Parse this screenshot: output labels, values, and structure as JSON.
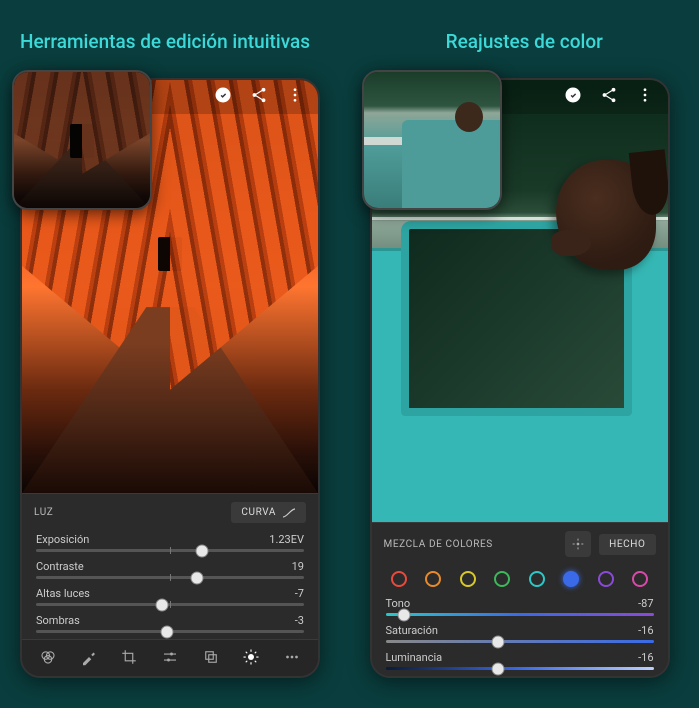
{
  "left": {
    "headline": "Herramientas de edición intuitivas",
    "panel_title": "LUZ",
    "curve_btn": "CURVA",
    "sliders": [
      {
        "label": "Exposición",
        "value": "1.23EV",
        "pos": 62
      },
      {
        "label": "Contraste",
        "value": "19",
        "pos": 60
      },
      {
        "label": "Altas luces",
        "value": "-7",
        "pos": 47
      },
      {
        "label": "Sombras",
        "value": "-3",
        "pos": 49
      }
    ]
  },
  "right": {
    "headline": "Reajustes de color",
    "panel_title": "MEZCLA DE COLORES",
    "done_btn": "HECHO",
    "colors": [
      {
        "name": "red",
        "hex": "#e84a3d"
      },
      {
        "name": "orange",
        "hex": "#e88a2a"
      },
      {
        "name": "yellow",
        "hex": "#d8c82a"
      },
      {
        "name": "green",
        "hex": "#3db85a"
      },
      {
        "name": "aqua",
        "hex": "#2ac8c8"
      },
      {
        "name": "blue",
        "hex": "#3a6ae8"
      },
      {
        "name": "purple",
        "hex": "#8a4ad8"
      },
      {
        "name": "magenta",
        "hex": "#d84aa8"
      }
    ],
    "selected_color_index": 5,
    "sliders": [
      {
        "label": "Tono",
        "value": "-87",
        "pos": 7
      },
      {
        "label": "Saturación",
        "value": "-16",
        "pos": 42
      },
      {
        "label": "Luminancia",
        "value": "-16",
        "pos": 42
      }
    ]
  }
}
